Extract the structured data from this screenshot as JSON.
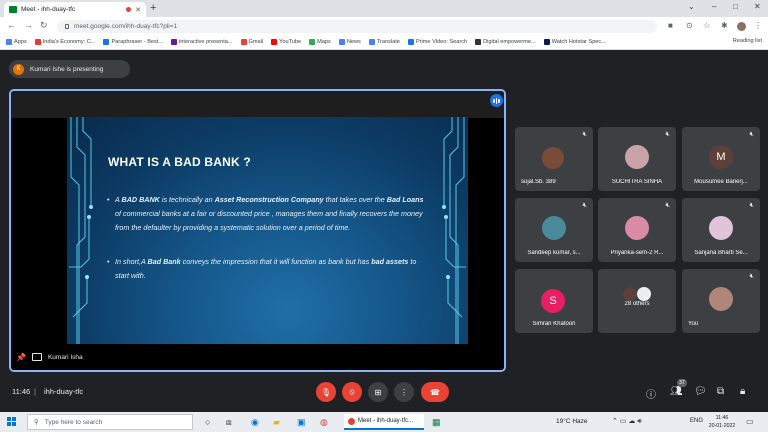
{
  "browser": {
    "tab_title": "Meet - ihh-duay-tfc",
    "new_tab": "+",
    "url": "meet.google.com/ihh-duay-tfc?pli=1",
    "bookmarks": [
      {
        "label": "Apps",
        "color": "#4285f4"
      },
      {
        "label": "India's Economy: C...",
        "color": "#e53935"
      },
      {
        "label": "Paraphraser - Best...",
        "color": "#1a73e8"
      },
      {
        "label": "interactive presenta...",
        "color": "#6a1b9a"
      },
      {
        "label": "Gmail",
        "color": "#ea4335"
      },
      {
        "label": "YouTube",
        "color": "#ff0000"
      },
      {
        "label": "Maps",
        "color": "#34a853"
      },
      {
        "label": "News",
        "color": "#4285f4"
      },
      {
        "label": "Translate",
        "color": "#4285f4"
      },
      {
        "label": "Prime Video: Search",
        "color": "#1a73e8"
      },
      {
        "label": "Digital empowerme...",
        "color": "#333333"
      },
      {
        "label": "Watch Hotstar Spec...",
        "color": "#0c1a4e"
      }
    ],
    "reading_list": "Reading list",
    "window_controls": [
      "⌄",
      "–",
      "□",
      "✕"
    ]
  },
  "meet": {
    "presenting_initial": "K",
    "presenting_text": "Kumari Ishe is presenting",
    "presenter_name": "Kumari Isha",
    "time": "11:46",
    "meeting_code": "ihh-duay-tfc",
    "people_count": "37",
    "participants": [
      {
        "name": "sujal.Sb. 389",
        "initial": "",
        "avatar_color": "#7b4b3a"
      },
      {
        "name": "SUCHITRA SINHA",
        "initial": "",
        "avatar_color": "#c9a3a8"
      },
      {
        "name": "Mousumee Banerj...",
        "initial": "M",
        "avatar_color": "#5d4037"
      },
      {
        "name": "Sandeep kumar, s...",
        "initial": "",
        "avatar_color": "#4a8a9a"
      },
      {
        "name": "Priyanka-sem-2 R...",
        "initial": "",
        "avatar_color": "#d98aa5"
      },
      {
        "name": "Sanjana Bharti Se...",
        "initial": "",
        "avatar_color": "#e0c4d8"
      },
      {
        "name": "Simran Khatoon",
        "initial": "S",
        "avatar_color": "#e91e63"
      },
      {
        "name": "28 others",
        "initial": "",
        "avatar_color": "#5f6368"
      },
      {
        "name": "You",
        "initial": "",
        "avatar_color": "#b0857a"
      }
    ]
  },
  "slide": {
    "title": "WHAT IS A BAD BANK ?",
    "bullet1_pre": "A ",
    "bullet1_b1": "BAD BANK",
    "bullet1_mid": " is technically an ",
    "bullet1_b2": "Asset Reconstruction Company",
    "bullet1_mid2": " that takes over the ",
    "bullet1_b3": "Bad Loans",
    "bullet1_post": " of commercial banks at a fair or discounted price , manages them and finally recovers the money from the defaulter by providing a systematic solution over a period of time.",
    "bullet2_pre": "In short,A ",
    "bullet2_b1": "Bad Bank",
    "bullet2_mid": " conveys the impression that it will function as bank but has ",
    "bullet2_b2": "bad assets",
    "bullet2_post": " to start with."
  },
  "taskbar": {
    "search_placeholder": "Type here to search",
    "meet_app": "Meet - ihh-duay-tfc...",
    "weather": "19°C Haze",
    "lang": "ENG",
    "clock_time": "11:46",
    "clock_date": "20-01-2022"
  }
}
